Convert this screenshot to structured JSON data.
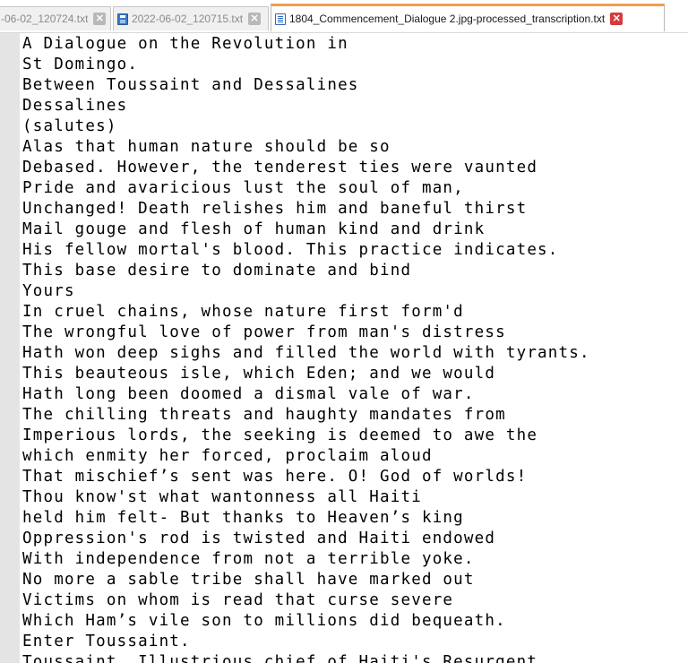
{
  "tabs": [
    {
      "label": "-06-02_120724.txt",
      "icon": "notepad-file-icon",
      "active": false
    },
    {
      "label": "2022-06-02_120715.txt",
      "icon": "saved-file-icon",
      "active": false
    },
    {
      "label": "1804_Commencement_Dialogue 2.jpg-processed_transcription.txt",
      "icon": "saved-file-icon",
      "active": true
    }
  ],
  "close_glyph": "✕",
  "editor": {
    "lines": [
      "A Dialogue on the Revolution in",
      "St Domingo.",
      "Between Toussaint and Dessalines",
      "Dessalines",
      "(salutes)",
      "Alas that human nature should be so",
      "Debased. However, the tenderest ties were vaunted",
      "Pride and avaricious lust the soul of man,",
      "Unchanged! Death relishes him and baneful thirst",
      "Mail gouge and flesh of human kind and drink",
      "His fellow mortal's blood. This practice indicates.",
      "This base desire to dominate and bind",
      "Yours",
      "In cruel chains, whose nature first form'd",
      "The wrongful love of power from man's distress",
      "Hath won deep sighs and filled the world with tyrants.",
      "This beauteous isle, which Eden; and we would",
      "Hath long been doomed a dismal vale of war.",
      "The chilling threats and haughty mandates from",
      "Imperious lords, the seeking is deemed to awe the",
      "which enmity her forced, proclaim aloud",
      "That mischief’s sent was here. O! God of worlds!",
      "Thou know'st what wantonness all Haiti",
      "held him felt- But thanks to Heaven’s king",
      "Oppression's rod is twisted and Haiti endowed",
      "With independence from not a terrible yoke.",
      "No more a sable tribe shall have marked out",
      "Victims on whom is read that curse severe",
      "Which Ham’s vile son to millions did bequeath.",
      "Enter Toussaint.",
      "Toussaint. Illustrious chief of Haiti's Resurgent"
    ]
  },
  "colors": {
    "active_tab_accent": "#f0a04a",
    "close_active": "#d83a3a",
    "close_inactive": "#b8b8b8",
    "gutter": "#e4e4e4"
  }
}
